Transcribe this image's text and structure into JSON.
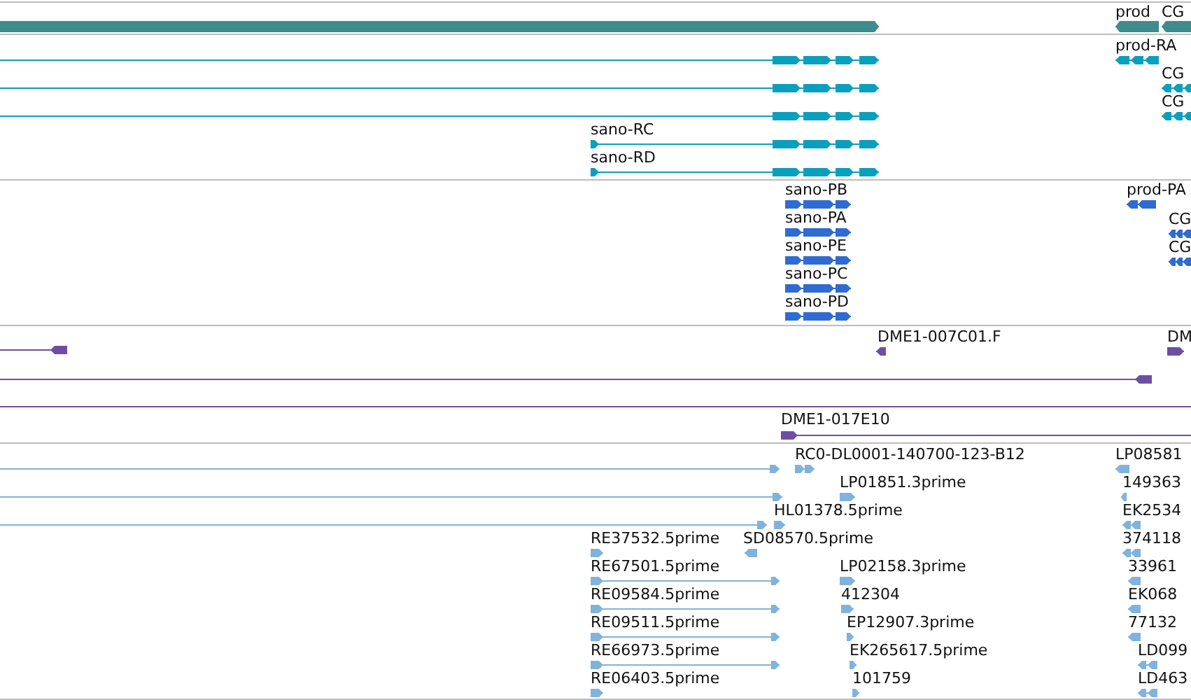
{
  "tracks": [
    {
      "kind": "gene",
      "color": "#3f8c8c",
      "features": [
        {
          "reverse": false
        },
        {
          "label": "prod",
          "reverse": true
        },
        {
          "label": "CG",
          "reverse": true
        }
      ]
    },
    {
      "kind": "transcript",
      "color": "#0aa0bd",
      "features": [
        {
          "reverse": false
        },
        {
          "reverse": false
        },
        {
          "reverse": false
        },
        {
          "label": "sano-RC",
          "reverse": false
        },
        {
          "label": "sano-RD",
          "reverse": false
        },
        {
          "label": "prod-RA",
          "reverse": true
        },
        {
          "label": "CG",
          "reverse": true
        },
        {
          "label": "CG",
          "reverse": true
        }
      ]
    },
    {
      "kind": "protein",
      "color": "#2f6bd0",
      "features": [
        {
          "label": "sano-PB",
          "reverse": false
        },
        {
          "label": "sano-PA",
          "reverse": false
        },
        {
          "label": "sano-PE",
          "reverse": false
        },
        {
          "label": "sano-PC",
          "reverse": false
        },
        {
          "label": "sano-PD",
          "reverse": false
        },
        {
          "label": "prod-PA",
          "reverse": true
        },
        {
          "label": "CG",
          "reverse": true
        },
        {
          "label": "CG",
          "reverse": true
        }
      ]
    },
    {
      "kind": "clone",
      "color": "#6c4fa3",
      "spanning_line": true,
      "features": [
        {
          "reverse": true
        },
        {
          "label": "DME1-007C01.F",
          "reverse": true
        },
        {
          "label": "DM",
          "reverse": false
        },
        {
          "reverse": true
        },
        {
          "label": "DME1-017E10",
          "reverse": false
        }
      ]
    },
    {
      "kind": "est",
      "color": "#7fb3dc",
      "features": [
        {
          "reverse": false
        },
        {
          "reverse": false
        },
        {
          "reverse": false
        },
        {
          "label": "RC0-DL0001-140700-123-B12",
          "reverse": false
        },
        {
          "label": "LP01851.3prime",
          "reverse": false
        },
        {
          "label": "HL01378.5prime",
          "reverse": false
        },
        {
          "label": "RE37532.5prime",
          "reverse": false
        },
        {
          "label": "SD08570.5prime",
          "reverse": true
        },
        {
          "label": "RE67501.5prime",
          "reverse": false
        },
        {
          "label": "RE09584.5prime",
          "reverse": false
        },
        {
          "label": "RE09511.5prime",
          "reverse": false
        },
        {
          "label": "RE66973.5prime",
          "reverse": false
        },
        {
          "label": "RE06403.5prime",
          "reverse": false
        },
        {
          "label": "LP02158.3prime",
          "reverse": false
        },
        {
          "label": "412304",
          "reverse": false
        },
        {
          "label": "EP12907.3prime",
          "reverse": false
        },
        {
          "label": "EK265617.5prime",
          "reverse": false
        },
        {
          "label": "101759",
          "reverse": false
        },
        {
          "label": "LP08581",
          "reverse": true
        },
        {
          "label": "149363",
          "reverse": true
        },
        {
          "label": "EK2534",
          "reverse": true
        },
        {
          "label": "374118",
          "reverse": true
        },
        {
          "label": "33961",
          "reverse": true
        },
        {
          "label": "EK068",
          "reverse": true
        },
        {
          "label": "77132",
          "reverse": true
        },
        {
          "label": "LD099",
          "reverse": true
        },
        {
          "label": "LD463",
          "reverse": true
        }
      ]
    }
  ]
}
